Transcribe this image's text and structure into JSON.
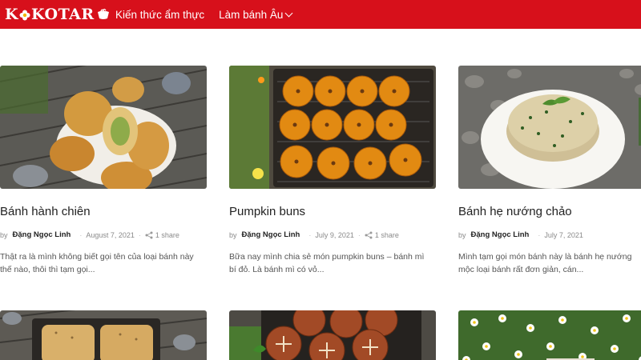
{
  "header": {
    "logo_text": "KOKOTARO",
    "nav": [
      {
        "label": "Kiến thức ẩm thực",
        "has_dropdown": false
      },
      {
        "label": "Làm bánh Âu",
        "has_dropdown": true
      }
    ],
    "brand_color": "#d7101b"
  },
  "posts": [
    {
      "title": "Bánh hành chiên",
      "by": "by",
      "author": "Đặng Ngọc Linh",
      "date": "August 7, 2021",
      "shares": "1 share",
      "excerpt": "Thật ra là mình không biết gọi tên của loại bánh này\nthế nào, thôi thì tạm gọi...",
      "image": "fried-scallion-buns-photo"
    },
    {
      "title": "Pumpkin buns",
      "by": "by",
      "author": "Đặng Ngọc Linh",
      "date": "July 9, 2021",
      "shares": "1 share",
      "excerpt": "Bữa nay mình chia sẻ món pumpkin buns – bánh mì\nbí đỏ. Là bánh mì có vỏ...",
      "image": "pumpkin-buns-photo"
    },
    {
      "title": "Bánh hẹ nướng chảo",
      "by": "by",
      "author": "Đặng Ngọc Linh",
      "date": "July 7, 2021",
      "shares": "",
      "excerpt": "Mình tạm gọi món bánh này là bánh hẹ nướng\nmộc loại bánh rất đơn giản, cán...",
      "image": "chive-pancakes-photo"
    }
  ],
  "posts_row2": [
    {
      "image": "bread-loaves-photo"
    },
    {
      "image": "scored-buns-photo"
    },
    {
      "image": "daisies-photo"
    }
  ]
}
